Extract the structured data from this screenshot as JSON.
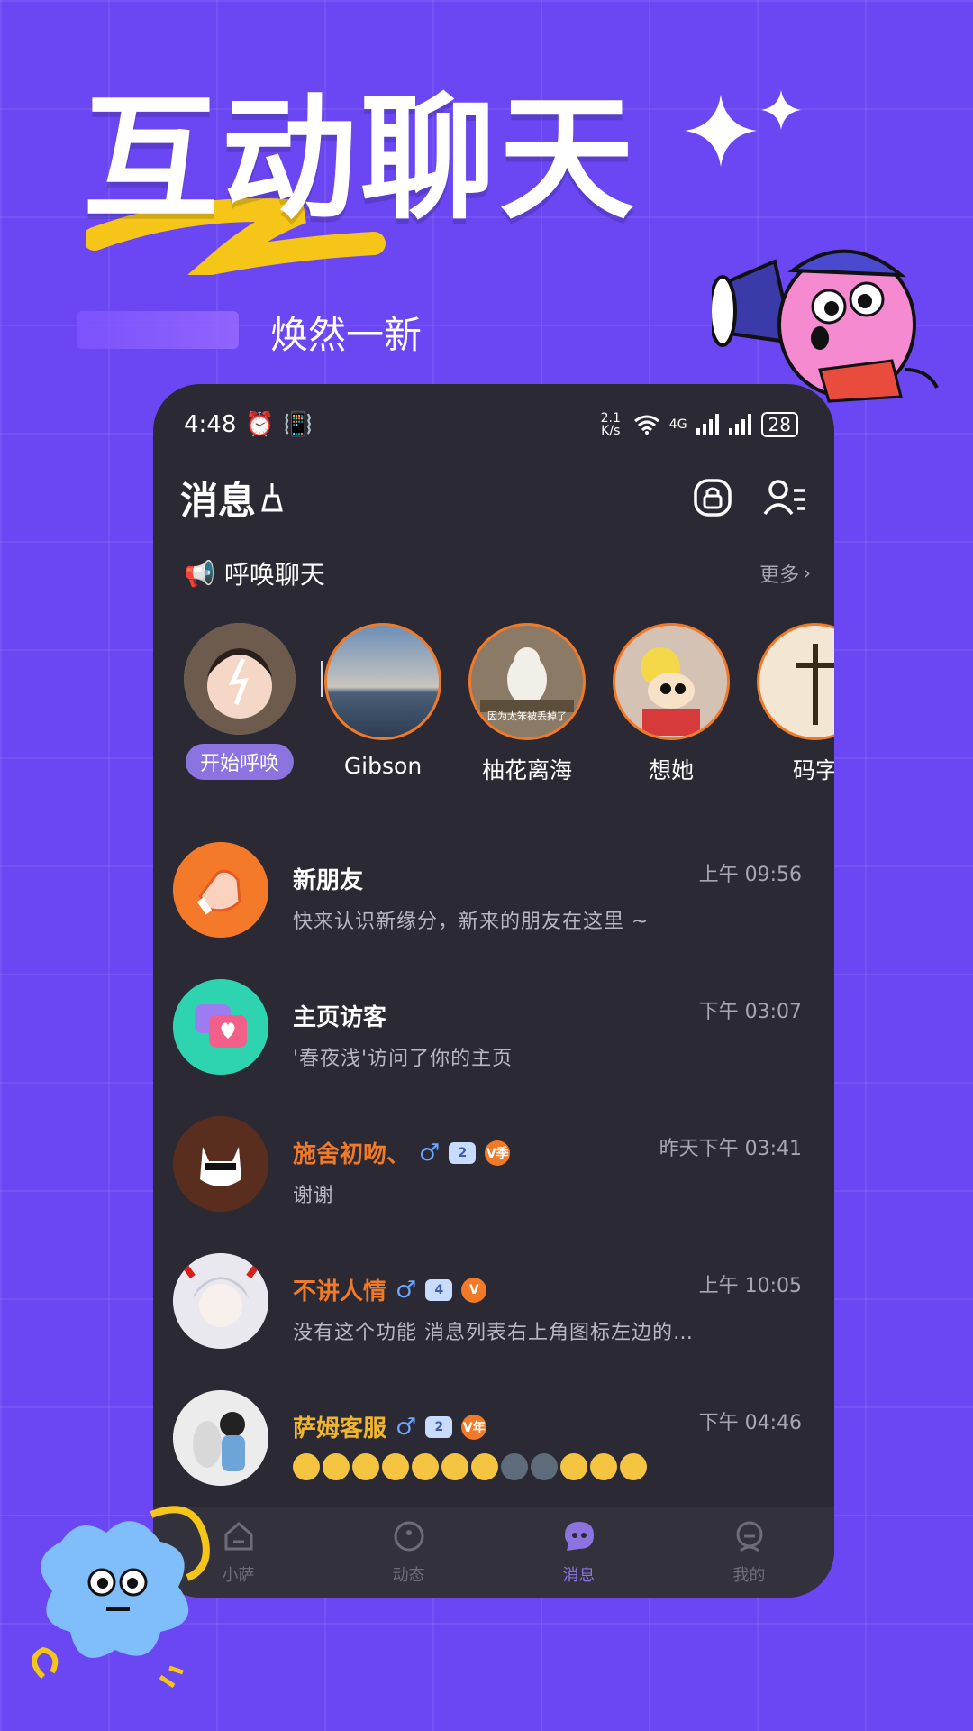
{
  "promo": {
    "title": "互动聊天",
    "subtitle": "焕然一新"
  },
  "status_bar": {
    "time": "4:48",
    "net_speed": "2.1 K/s",
    "network": "4G",
    "battery": "28"
  },
  "header": {
    "title": "消息"
  },
  "call_section": {
    "label": "呼唤聊天",
    "more": "更多"
  },
  "stories": [
    {
      "name": "开始呼唤",
      "is_self": true
    },
    {
      "name": "Gibson"
    },
    {
      "name": "柚花离海",
      "caption": "因为太笨被丢掉了"
    },
    {
      "name": "想她"
    },
    {
      "name": "码字"
    }
  ],
  "messages": [
    {
      "title": "新朋友",
      "time": "上午 09:56",
      "preview": "快来认识新缘分，新来的朋友在这里 ~",
      "title_color": "white"
    },
    {
      "title": "主页访客",
      "time": "下午 03:07",
      "preview": "'春夜浅'访问了你的主页",
      "title_color": "white"
    },
    {
      "title": "施舍初吻、",
      "time": "昨天下午 03:41",
      "preview": "谢谢",
      "title_color": "orange",
      "gender": "♂",
      "level": "2",
      "vip": "V季"
    },
    {
      "title": "不讲人情",
      "time": "上午 10:05",
      "preview": "没有这个功能 消息列表右上角图标左边的…",
      "title_color": "orange",
      "gender": "♂",
      "level": "4",
      "vip": "V"
    },
    {
      "title": "萨姆客服",
      "time": "下午 04:46",
      "preview": "",
      "title_color": "yellow",
      "gender": "♂",
      "level": "2",
      "vip": "V年"
    }
  ],
  "tabs": [
    {
      "label": "小萨",
      "icon": "home-icon"
    },
    {
      "label": "动态",
      "icon": "circle-icon"
    },
    {
      "label": "消息",
      "icon": "chat-icon",
      "active": true
    },
    {
      "label": "我的",
      "icon": "profile-icon"
    }
  ],
  "colors": {
    "background": "#6a47f2",
    "phone": "#2b2a34",
    "accent_orange": "#f07a28",
    "accent_purple": "#8b74e0"
  }
}
